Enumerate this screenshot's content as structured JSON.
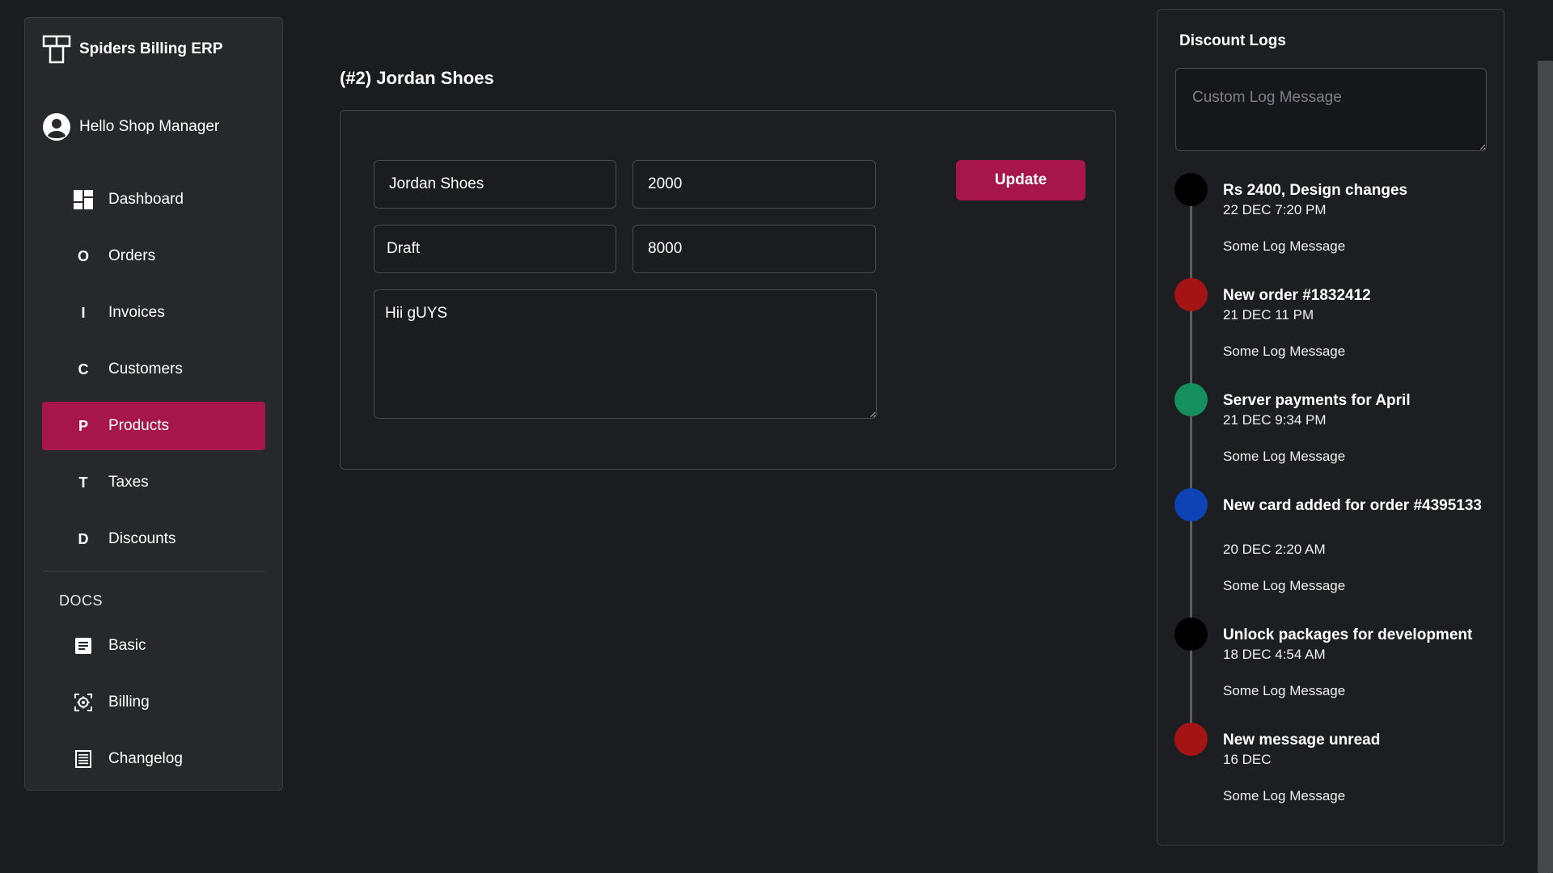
{
  "app": {
    "name": "Spiders Billing ERP",
    "greeting": "Hello Shop Manager"
  },
  "sidebar": {
    "items": [
      {
        "label": "Dashboard",
        "icon": "dashboard-icon",
        "glyph": ""
      },
      {
        "label": "Orders",
        "icon": "letter-o-icon",
        "glyph": "O"
      },
      {
        "label": "Invoices",
        "icon": "letter-i-icon",
        "glyph": "I"
      },
      {
        "label": "Customers",
        "icon": "letter-c-icon",
        "glyph": "C"
      },
      {
        "label": "Products",
        "icon": "letter-p-icon",
        "glyph": "P",
        "active": true
      },
      {
        "label": "Taxes",
        "icon": "letter-t-icon",
        "glyph": "T"
      },
      {
        "label": "Discounts",
        "icon": "letter-d-icon",
        "glyph": "D"
      }
    ],
    "docs_header": "DOCS",
    "docs": [
      {
        "label": "Basic",
        "icon": "document-icon"
      },
      {
        "label": "Billing",
        "icon": "billing-gear-icon"
      },
      {
        "label": "Changelog",
        "icon": "list-icon"
      }
    ]
  },
  "main": {
    "title": "(#2) Jordan Shoes",
    "form": {
      "name": "Jordan Shoes",
      "price": "2000",
      "status": "Draft",
      "stock": "8000",
      "description": "Hii gUYS",
      "update_label": "Update"
    }
  },
  "logs": {
    "title": "Discount Logs",
    "placeholder": "Custom Log Message",
    "entries": [
      {
        "title": "Rs 2400, Design changes",
        "time": "22 DEC 7:20 PM",
        "message": "Some Log Message",
        "color": "#000000"
      },
      {
        "title": "New order #1832412",
        "time": "21 DEC 11 PM",
        "message": "Some Log Message",
        "color": "#a41414"
      },
      {
        "title": "Server payments for April",
        "time": "21 DEC 9:34 PM",
        "message": "Some Log Message",
        "color": "#168f5f"
      },
      {
        "title": "New card added for order #4395133",
        "time": "20 DEC 2:20 AM",
        "message": "Some Log Message",
        "color": "#0d43b4"
      },
      {
        "title": "Unlock packages for development",
        "time": "18 DEC 4:54 AM",
        "message": "Some Log Message",
        "color": "#000000"
      },
      {
        "title": "New message unread",
        "time": "16 DEC",
        "message": "Some Log Message",
        "color": "#a41414"
      }
    ]
  },
  "colors": {
    "accent": "#a7164a",
    "background": "#1b1c1f",
    "panel": "#26282b"
  }
}
